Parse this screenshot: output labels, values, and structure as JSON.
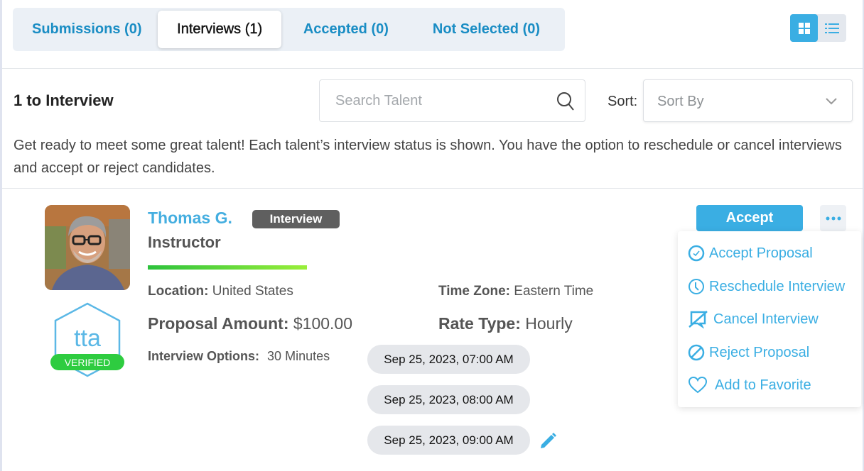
{
  "tabs": [
    {
      "label": "Submissions (0)",
      "active": false
    },
    {
      "label": "Interviews (1)",
      "active": true
    },
    {
      "label": "Accepted (0)",
      "active": false
    },
    {
      "label": "Not Selected (0)",
      "active": false
    }
  ],
  "view_toggle": {
    "active": "grid",
    "options": [
      "grid-icon",
      "list-icon"
    ]
  },
  "toolbar": {
    "count_title": "1 to Interview",
    "search_placeholder": "Search Talent",
    "search_value": "",
    "sort_label": "Sort:",
    "sort_value": "Sort By"
  },
  "description": "Get ready to meet some great talent! Each talent’s interview status is shown. You have the option to reschedule or cancel interviews and accept or reject candidates.",
  "candidate": {
    "name": "Thomas G.",
    "status": "Interview",
    "role": "Instructor",
    "profile_progress": 1.0,
    "verified_badge": {
      "logo": "tta",
      "label": "VERIFIED"
    },
    "location_label": "Location:",
    "location": "United States",
    "timezone_label": "Time Zone:",
    "timezone": "Eastern Time",
    "amount_label": "Proposal Amount:",
    "amount": "$100.00",
    "rate_label": "Rate Type:",
    "rate": "Hourly",
    "options_label": "Interview Options:",
    "options": "30 Minutes",
    "slots": [
      "Sep 25, 2023, 07:00 AM",
      "Sep 25, 2023, 08:00 AM",
      "Sep 25, 2023, 09:00 AM"
    ]
  },
  "actions": {
    "accept_label": "Accept",
    "menu": [
      {
        "label": "Accept Proposal",
        "icon": "check-circle-icon"
      },
      {
        "label": "Reschedule Interview",
        "icon": "clock-icon"
      },
      {
        "label": "Cancel Interview",
        "icon": "cancel-chat-icon"
      },
      {
        "label": "Reject Proposal",
        "icon": "ban-icon"
      },
      {
        "label": "Add to Favorite",
        "icon": "heart-icon"
      }
    ]
  },
  "colors": {
    "accent": "#3aaee3",
    "tab_link": "#1a8dc4",
    "status_pill": "#5f5f5f",
    "slot_bg": "#e5e7eb",
    "verified_green": "#2ecc40"
  }
}
